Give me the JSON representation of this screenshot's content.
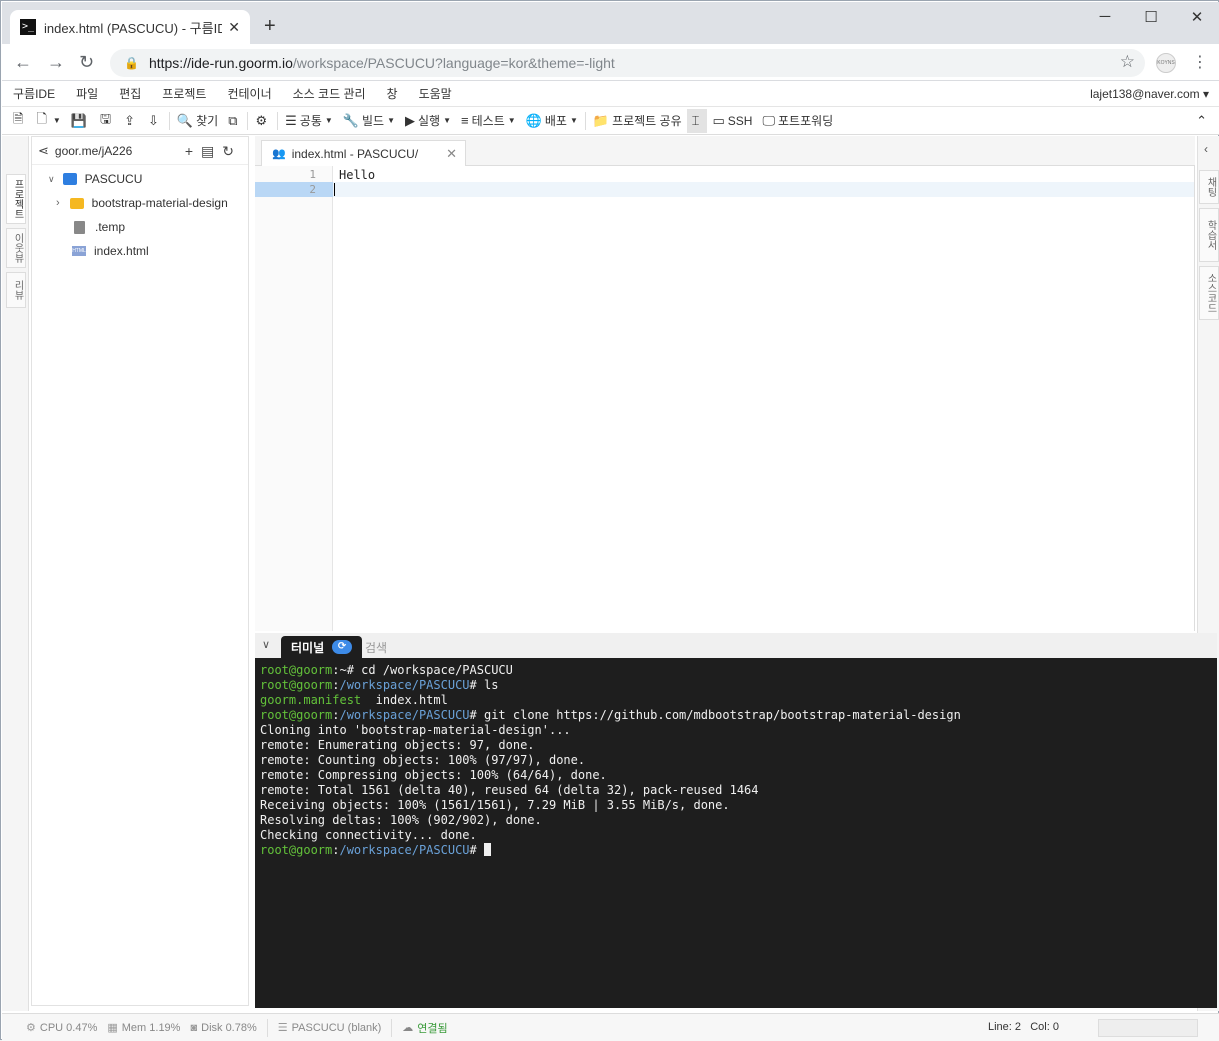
{
  "browser": {
    "tab_title": "index.html (PASCUCU) - 구름IDE",
    "favicon": ">_",
    "new_tab": "+",
    "url_host": "https://ide-run.goorm.io",
    "url_path": "/workspace/PASCUCU?language=kor&theme=-light",
    "ext_label": "KOYNS"
  },
  "menu": {
    "items": [
      "구름IDE",
      "파일",
      "편집",
      "프로젝트",
      "컨테이너",
      "소스 코드 관리",
      "창",
      "도움말"
    ],
    "user": "lajet138@naver.com"
  },
  "toolbar": {
    "find": "찾기",
    "common": "공통",
    "build": "빌드",
    "run": "실행",
    "test": "테스트",
    "deploy": "배포",
    "share": "프로젝트 공유",
    "ssh": "SSH",
    "portfwd": "포트포워딩"
  },
  "left_tabs": [
    "프로젝트",
    "이웃뷰",
    "리뷰"
  ],
  "right_tabs": [
    "채팅",
    "학습서",
    "소스코드"
  ],
  "explorer": {
    "share_link": "goor.me/jA226",
    "project": "PASCUCU",
    "items": [
      {
        "name": "bootstrap-material-design",
        "type": "folder"
      },
      {
        "name": ".temp",
        "type": "file"
      },
      {
        "name": "index.html",
        "type": "html"
      }
    ]
  },
  "editor": {
    "tab_label": "index.html - PASCUCU/",
    "lines": [
      {
        "n": "1",
        "text": "Hello"
      },
      {
        "n": "2",
        "text": ""
      }
    ]
  },
  "terminal": {
    "tab_label": "터미널",
    "search_tab": "검색",
    "lines": [
      {
        "user": "root@goorm",
        "path": ":~",
        "cmd": "# cd /workspace/PASCUCU"
      },
      {
        "user": "root@goorm",
        "path": ":/workspace/PASCUCU",
        "cmd": "# ls"
      },
      {
        "green": "goorm.manifest",
        "out": "  index.html"
      },
      {
        "user": "root@goorm",
        "path": ":/workspace/PASCUCU",
        "cmd": "# git clone https://github.com/mdbootstrap/bootstrap-material-design"
      },
      {
        "out": "Cloning into 'bootstrap-material-design'..."
      },
      {
        "out": "remote: Enumerating objects: 97, done."
      },
      {
        "out": "remote: Counting objects: 100% (97/97), done."
      },
      {
        "out": "remote: Compressing objects: 100% (64/64), done."
      },
      {
        "out": "remote: Total 1561 (delta 40), reused 64 (delta 32), pack-reused 1464"
      },
      {
        "out": "Receiving objects: 100% (1561/1561), 7.29 MiB | 3.55 MiB/s, done."
      },
      {
        "out": "Resolving deltas: 100% (902/902), done."
      },
      {
        "out": "Checking connectivity... done."
      },
      {
        "user": "root@goorm",
        "path": ":/workspace/PASCUCU",
        "cmd": "# "
      }
    ]
  },
  "status": {
    "cpu": "CPU 0.47%",
    "mem": "Mem 1.19%",
    "disk": "Disk 0.78%",
    "project": "PASCUCU (blank)",
    "connection": "연결됨",
    "line": "Line: 2",
    "col": "Col: 0"
  },
  "colors": {
    "terminal_bg": "#1e1e1e",
    "prompt_user": "#63c23a",
    "prompt_path": "#6aa1d8",
    "accent": "#2e7ee0"
  }
}
